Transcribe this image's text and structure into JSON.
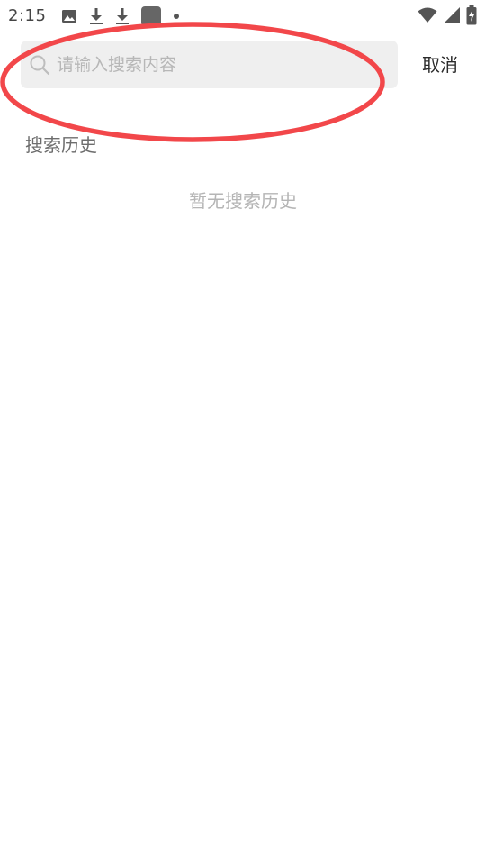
{
  "status_bar": {
    "time": "2:15",
    "left_icons": [
      "image-icon",
      "download-icon",
      "download-icon",
      "app-square-icon",
      "dot-icon"
    ],
    "right_icons": [
      "wifi-icon",
      "cellular-signal-icon",
      "battery-charging-icon"
    ]
  },
  "search": {
    "placeholder": "请输入搜索内容",
    "value": "",
    "cancel_label": "取消"
  },
  "history": {
    "title": "搜索历史",
    "empty_text": "暂无搜索历史",
    "items": []
  },
  "annotation": {
    "shape": "ellipse",
    "color": "#f2474a",
    "target": "search-box"
  },
  "colors": {
    "search_bg": "#efefef",
    "placeholder": "#b7b7b7",
    "section_title": "#6d6d6d",
    "empty_text": "#b5b5b5"
  }
}
